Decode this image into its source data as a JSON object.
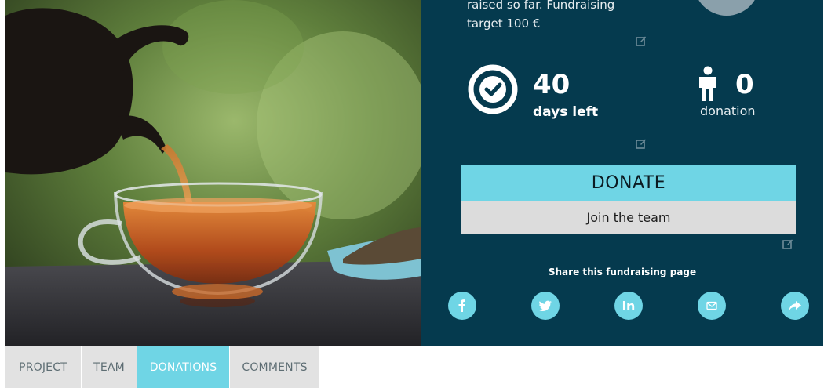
{
  "campaign": {
    "raised_line1": "raised so far. Fundraising",
    "raised_line2": "target 100 €"
  },
  "stats": {
    "days_left_value": "40",
    "days_left_label": "days left",
    "donations_value": "0",
    "donations_label": "donation"
  },
  "actions": {
    "donate_label": "DONATE",
    "join_label": "Join the team"
  },
  "share": {
    "title": "Share this fundraising page",
    "buttons": [
      {
        "icon": "facebook-icon"
      },
      {
        "icon": "twitter-icon"
      },
      {
        "icon": "linkedin-icon",
        "text": "in"
      },
      {
        "icon": "email-icon"
      },
      {
        "icon": "share-arrow-icon"
      }
    ]
  },
  "tabs": [
    {
      "label": "PROJECT",
      "active": false
    },
    {
      "label": "TEAM",
      "active": false
    },
    {
      "label": "DONATIONS",
      "active": true
    },
    {
      "label": "COMMENTS",
      "active": false
    }
  ],
  "colors": {
    "panel_bg": "#053a4e",
    "accent": "#6fd5e5",
    "secondary_button": "#dcdcdc",
    "tab_bg": "#e2e2e2"
  }
}
